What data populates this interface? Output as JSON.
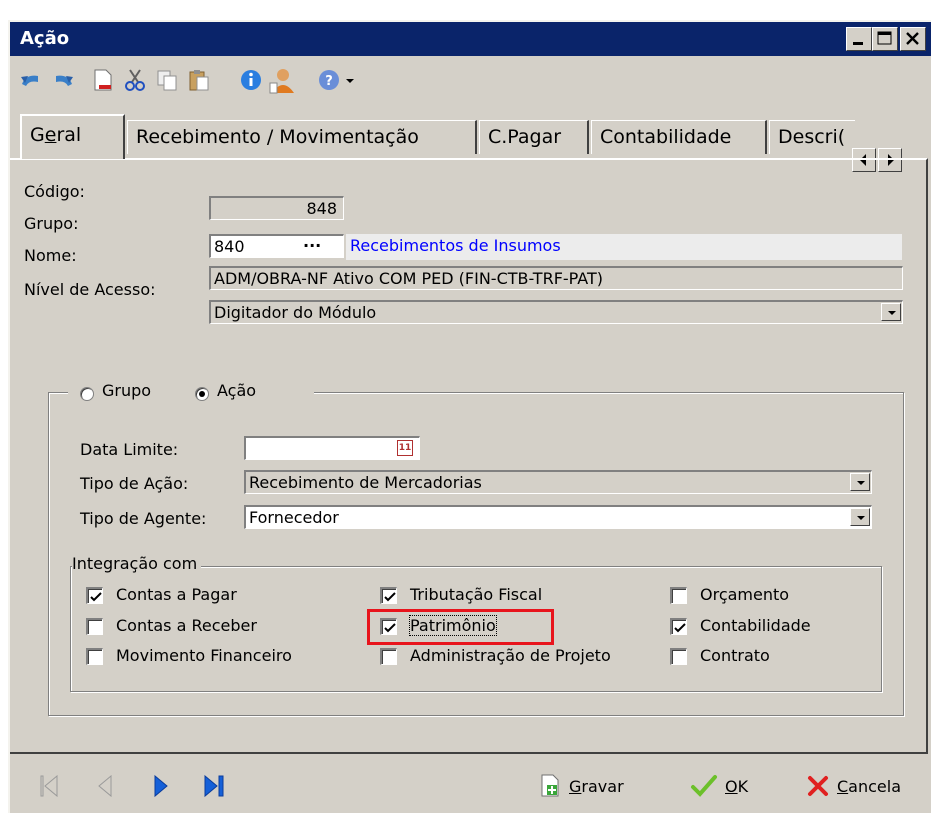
{
  "window": {
    "title": "Ação",
    "controls": [
      "minimize-icon",
      "maximize-icon",
      "close-icon"
    ]
  },
  "toolbar": {
    "icons": [
      "undo-icon",
      "redo-icon",
      "new-document-icon",
      "cut-icon",
      "copy-icon",
      "paste-icon",
      "info-icon",
      "user-icon",
      "help-icon",
      "dropdown-arrow-icon"
    ]
  },
  "tabs": [
    {
      "label": "Geral",
      "hotkey_prefix": "G",
      "hotkey": "e",
      "hotkey_suffix": "ral",
      "active": true
    },
    {
      "label": "Recebimento / Movimentação"
    },
    {
      "label": "C.Pagar"
    },
    {
      "label": "Contabilidade"
    },
    {
      "label": "Descri("
    }
  ],
  "form": {
    "codigo_label": "Código:",
    "codigo_value": "848",
    "grupo_label": "Grupo:",
    "grupo_code": "840",
    "grupo_ellipsis": "···",
    "grupo_desc": "Recebimentos de Insumos",
    "nome_label": "Nome:",
    "nome_value": "ADM/OBRA-NF Ativo COM PED (FIN-CTB-TRF-PAT)",
    "nivel_label": "Nível de Acesso:",
    "nivel_value": "Digitador do Módulo"
  },
  "scope": {
    "radio_grupo": "Grupo",
    "radio_acao": "Ação",
    "selected": "Ação",
    "data_limite_label": "Data Limite:",
    "data_limite_value": "",
    "calendar_glyph": "11",
    "tipo_acao_label": "Tipo de Ação:",
    "tipo_acao_value": "Recebimento de Mercadorias",
    "tipo_agente_label": "Tipo de Agente:",
    "tipo_agente_value": "Fornecedor"
  },
  "integracao": {
    "title": "Integração com",
    "items": [
      {
        "label": "Contas a Pagar",
        "checked": true
      },
      {
        "label": "Contas a Receber",
        "checked": false
      },
      {
        "label": "Movimento Financeiro",
        "checked": false
      },
      {
        "label": "Tributação Fiscal",
        "checked": true
      },
      {
        "label": "Patrimônio",
        "checked": true,
        "highlighted": true
      },
      {
        "label": "Administração de Projeto",
        "checked": false
      },
      {
        "label": "Orçamento",
        "checked": false
      },
      {
        "label": "Contabilidade",
        "checked": true
      },
      {
        "label": "Contrato",
        "checked": false
      }
    ],
    "highlight_color": "#e8141c"
  },
  "footer": {
    "nav_icons": [
      "first-record-icon",
      "previous-record-icon",
      "next-record-icon",
      "last-record-icon"
    ],
    "gravar_hotkey": "G",
    "gravar_rest": "ravar",
    "ok_hotkey": "O",
    "ok_rest": "K",
    "cancela_hotkey": "C",
    "cancela_rest": "ancela"
  },
  "colors": {
    "titlebar": "#0a246a",
    "face": "#d4d0c8",
    "link_blue": "#0000ff",
    "nav_active": "#1560d8"
  }
}
